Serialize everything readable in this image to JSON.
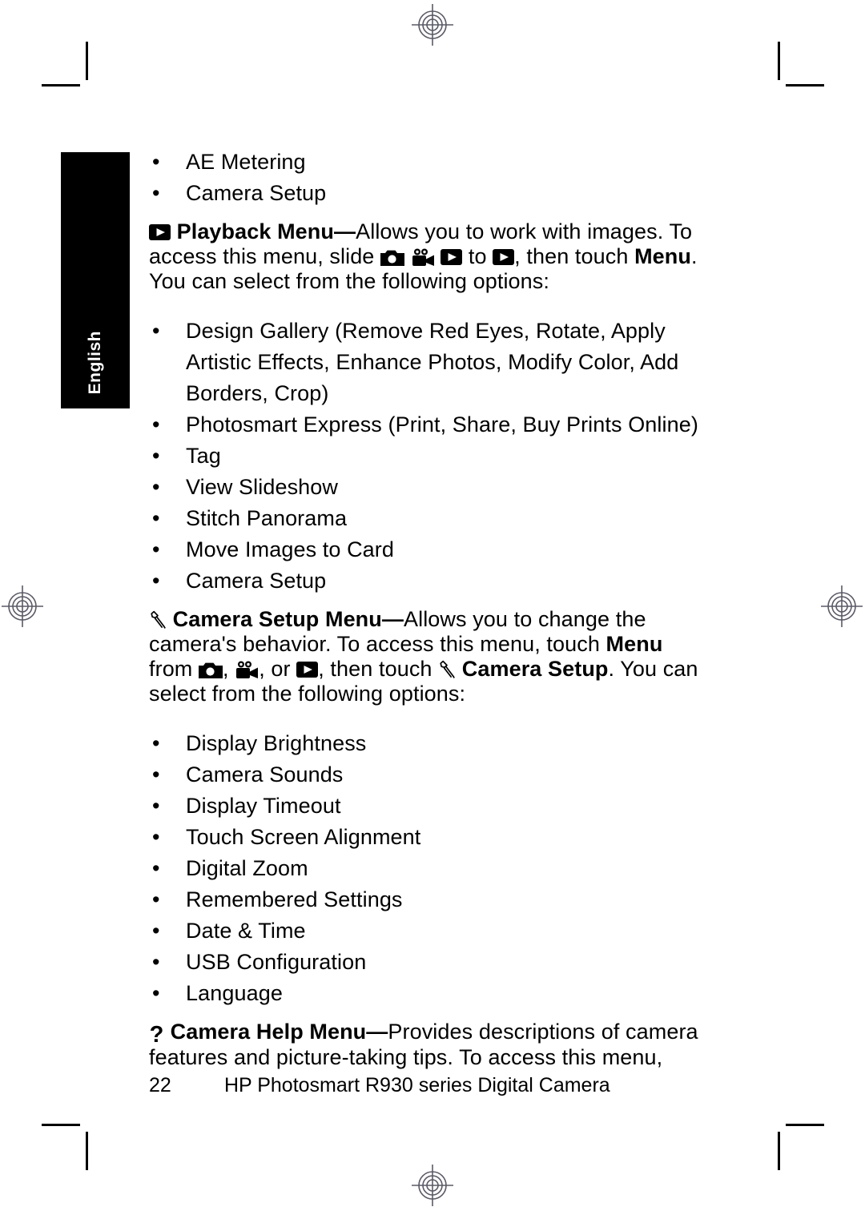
{
  "page": {
    "language_tab": "English",
    "page_number": "22",
    "footer_title": "HP Photosmart R930 series Digital Camera"
  },
  "top_list": {
    "items": [
      {
        "label": "AE Metering"
      },
      {
        "label": "Camera Setup"
      }
    ]
  },
  "playback_menu": {
    "icon": "play-icon",
    "title": "Playback Menu",
    "dash": "—",
    "desc_part1": "Allows you to work with images. To access this menu, slide ",
    "icon1": "camera-icon",
    "icon2": "video-camera-icon",
    "icon3": "play-icon",
    "mid_text": " to ",
    "icon4": "play-icon",
    "desc_part2": ", then touch ",
    "bold_word": "Menu",
    "desc_part3": ". You can select from the following options:"
  },
  "playback_options": {
    "items": [
      {
        "label": "Design Gallery (Remove Red Eyes, Rotate, Apply Artistic Effects, Enhance Photos, Modify Color, Add Borders, Crop)"
      },
      {
        "label": "Photosmart Express (Print, Share, Buy Prints Online)"
      },
      {
        "label": "Tag"
      },
      {
        "label": "View Slideshow"
      },
      {
        "label": "Stitch Panorama"
      },
      {
        "label": "Move Images to Card"
      },
      {
        "label": "Camera Setup"
      }
    ]
  },
  "camera_setup_menu": {
    "icon": "wrench-icon",
    "title": "Camera Setup Menu",
    "dash": "—",
    "desc_part1": "Allows you to change the camera's behavior. To access this menu, touch ",
    "bold_menu": "Menu",
    "desc_part2": " from ",
    "icon1": "camera-icon",
    "sep1": ", ",
    "icon2": "video-camera-icon",
    "sep2": ", or ",
    "icon3": "play-icon",
    "desc_part3": ", then touch ",
    "icon4": "wrench-icon",
    "bold_target": "Camera Setup",
    "desc_part4": ". You can select from the following options:"
  },
  "camera_setup_options": {
    "items": [
      {
        "label": "Display Brightness"
      },
      {
        "label": "Camera Sounds"
      },
      {
        "label": "Display Timeout"
      },
      {
        "label": "Touch Screen Alignment"
      },
      {
        "label": "Digital Zoom"
      },
      {
        "label": "Remembered Settings"
      },
      {
        "label": "Date & Time"
      },
      {
        "label": "USB Configuration"
      },
      {
        "label": "Language"
      }
    ]
  },
  "camera_help_menu": {
    "icon": "question-mark-icon",
    "icon_glyph": "?",
    "title": "Camera Help Menu",
    "dash": "—",
    "desc": "Provides descriptions of camera features and picture-taking tips. To access this menu,"
  },
  "bullet_glyph": "•",
  "colors": {
    "text": "#000000",
    "background": "#ffffff",
    "tab_background": "#000000",
    "tab_text": "#ffffff",
    "registration_mark": "#5a5a66"
  }
}
